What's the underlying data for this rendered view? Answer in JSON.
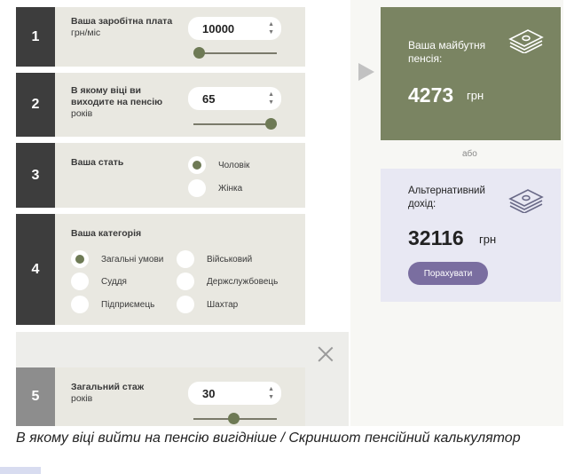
{
  "steps": [
    {
      "num": "1",
      "label": "Ваша заробітна плата",
      "sub": "грн/міс",
      "value": "10000",
      "slider_level": 0.0
    },
    {
      "num": "2",
      "label": "В якому віці ви виходите на пенсію",
      "sub": "років",
      "value": "65",
      "slider_level": 1.0
    },
    {
      "num": "3",
      "label": "Ваша стать",
      "options": [
        "Чоловік",
        "Жінка"
      ],
      "selected": "Чоловік"
    },
    {
      "num": "4",
      "label": "Ваша категорія",
      "options": [
        "Загальні умови",
        "Військовий",
        "Суддя",
        "Держслужбовець",
        "Підприємець",
        "Шахтар"
      ],
      "selected": "Загальні умови"
    },
    {
      "num": "5",
      "label": "Загальний стаж",
      "sub": "років",
      "value": "30",
      "slider_level": 0.5
    }
  ],
  "result": {
    "pension_label": "Ваша майбутня пенсія:",
    "pension_value": "4273",
    "pension_unit": "грн",
    "or": "або",
    "alt_label": "Альтернативний дохід:",
    "alt_value": "32116",
    "alt_unit": "грн",
    "calc_button": "Порахувати"
  },
  "icons": [
    "money-stack-icon",
    "close-icon",
    "arrow-right-icon"
  ],
  "colors": {
    "olive": "#7a8462",
    "dark": "#3d3d3d",
    "panel": "#e9e8e1",
    "lavender": "#e8e8f3",
    "button": "#7a6ea0"
  },
  "caption": "В якому віці вийти на пенсію вигідніше / Скриншот пенсійний калькулятор"
}
